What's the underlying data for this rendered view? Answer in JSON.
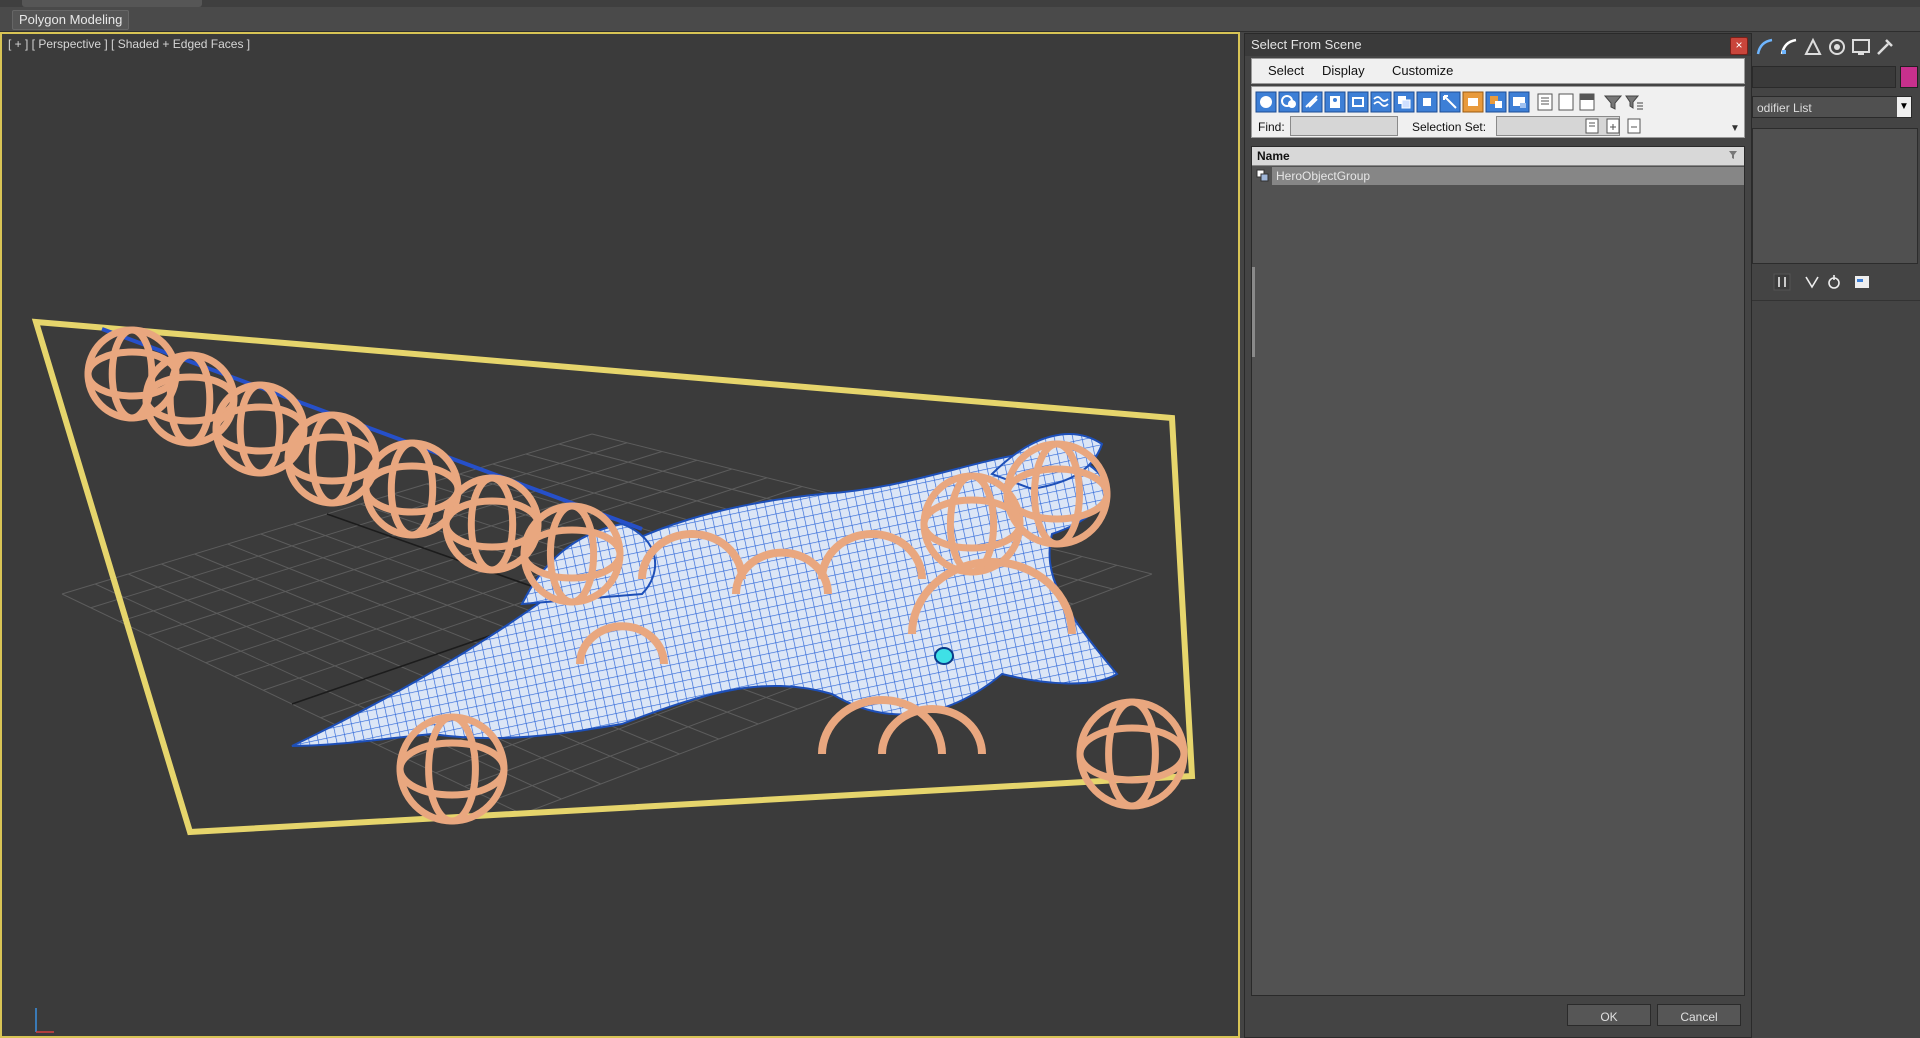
{
  "ribbon": {
    "panel_label": "Polygon Modeling"
  },
  "viewport": {
    "label": "[ + ] [ Perspective ] [ Shaded + Edged Faces ]",
    "selection_color": "#e6d56c",
    "mesh_color": "#2a64d8",
    "ring_color": "#e9a77f"
  },
  "command_panel": {
    "modifier_list_label": "odifier List",
    "object_color": "#c8308d"
  },
  "dialog": {
    "title": "Select From Scene",
    "close_icon": "close-icon",
    "menu": {
      "select": "Select",
      "display": "Display",
      "customize": "Customize"
    },
    "find_label": "Find:",
    "find_value": "",
    "selection_set_label": "Selection Set:",
    "selection_set_value": "",
    "list": {
      "column_name": "Name",
      "rows": [
        {
          "name": "HeroObjectGroup",
          "icon": "group-icon",
          "selected": true
        }
      ]
    },
    "ok_label": "OK",
    "cancel_label": "Cancel"
  }
}
